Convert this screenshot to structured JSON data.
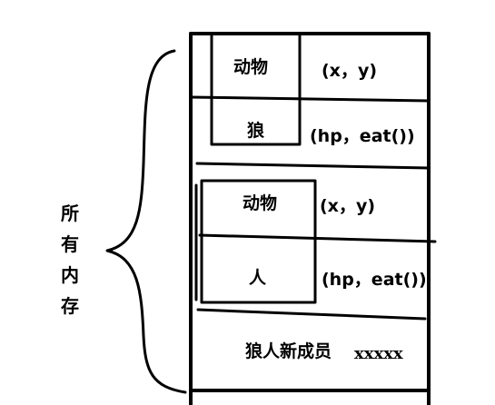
{
  "side_label": [
    "所",
    "有",
    "内",
    "存"
  ],
  "block1": {
    "parent_label": "动物",
    "parent_fields": "(x，y)",
    "child_label": "狼",
    "child_fields": "(hp，eat())"
  },
  "block2": {
    "parent_label": "动物",
    "parent_fields": "(x，y)",
    "child_label": "人",
    "child_fields": "(hp，eat())"
  },
  "block3": {
    "label": "狼人新成员",
    "fields": "xxxxx"
  },
  "colors": {
    "ink": "#000000",
    "background": "#ffffff"
  }
}
